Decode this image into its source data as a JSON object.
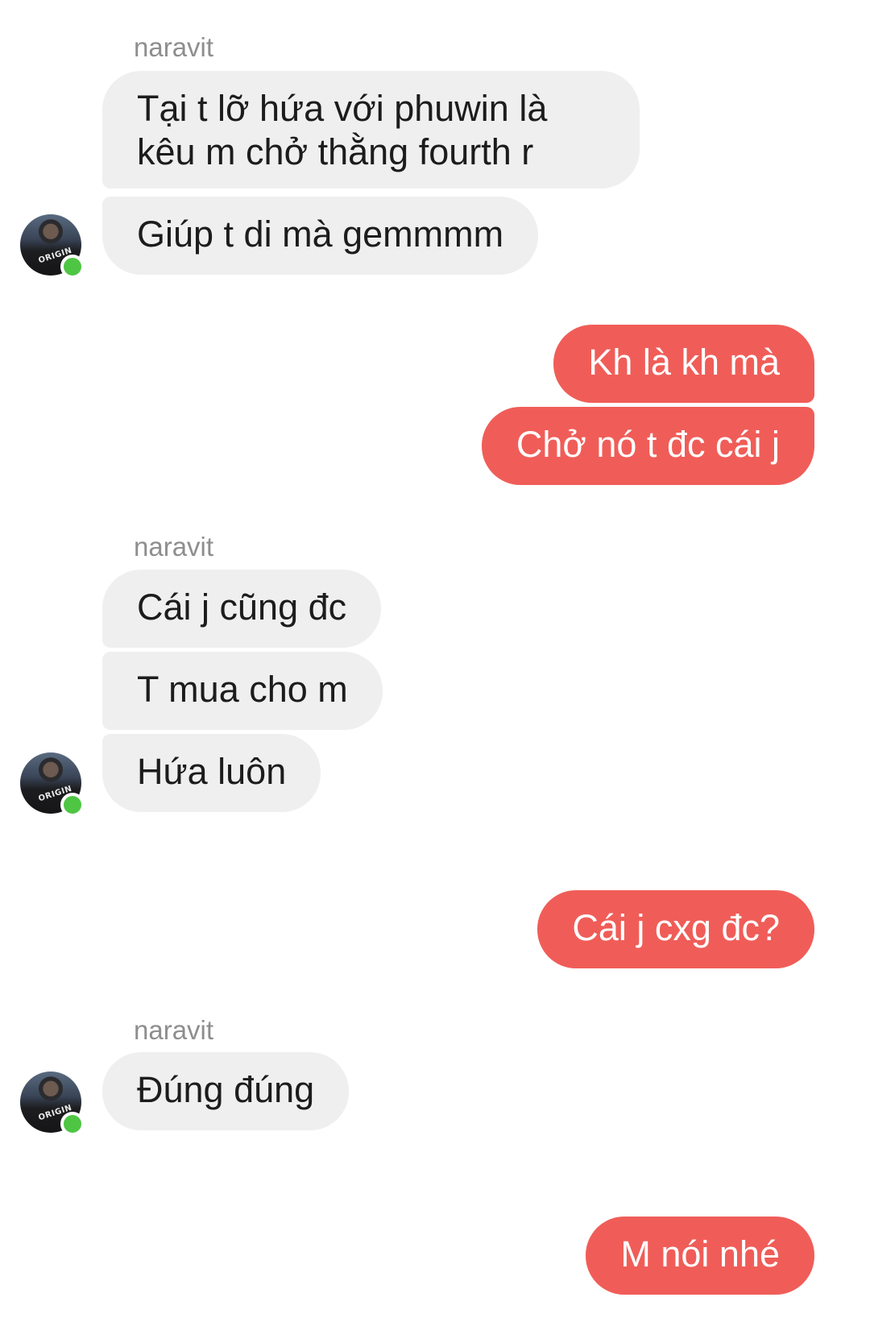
{
  "conversation": {
    "groups": [
      {
        "sender": "naravit",
        "messages": [
          "Tại t lỡ hứa với phuwin là kêu m chở thằng fourth r",
          "Giúp t di mà gemmmm"
        ]
      },
      {
        "sender": "me",
        "messages": [
          "Kh là kh mà",
          "Chở nó t đc cái j"
        ]
      },
      {
        "sender": "naravit",
        "messages": [
          "Cái j cũng đc",
          "T mua cho m",
          "Hứa luôn"
        ]
      },
      {
        "sender": "me",
        "messages": [
          "Cái j cxg đc?"
        ]
      },
      {
        "sender": "naravit",
        "messages": [
          "Đúng đúng"
        ]
      },
      {
        "sender": "me",
        "messages": [
          "M nói nhé"
        ]
      }
    ]
  },
  "avatar": {
    "icon": "user-avatar-icon",
    "status": "online",
    "status_color": "#4fc544"
  },
  "colors": {
    "incoming_bubble": "#efefef",
    "outgoing_bubble": "#f05d58",
    "sender_name": "#8e8e8e"
  }
}
